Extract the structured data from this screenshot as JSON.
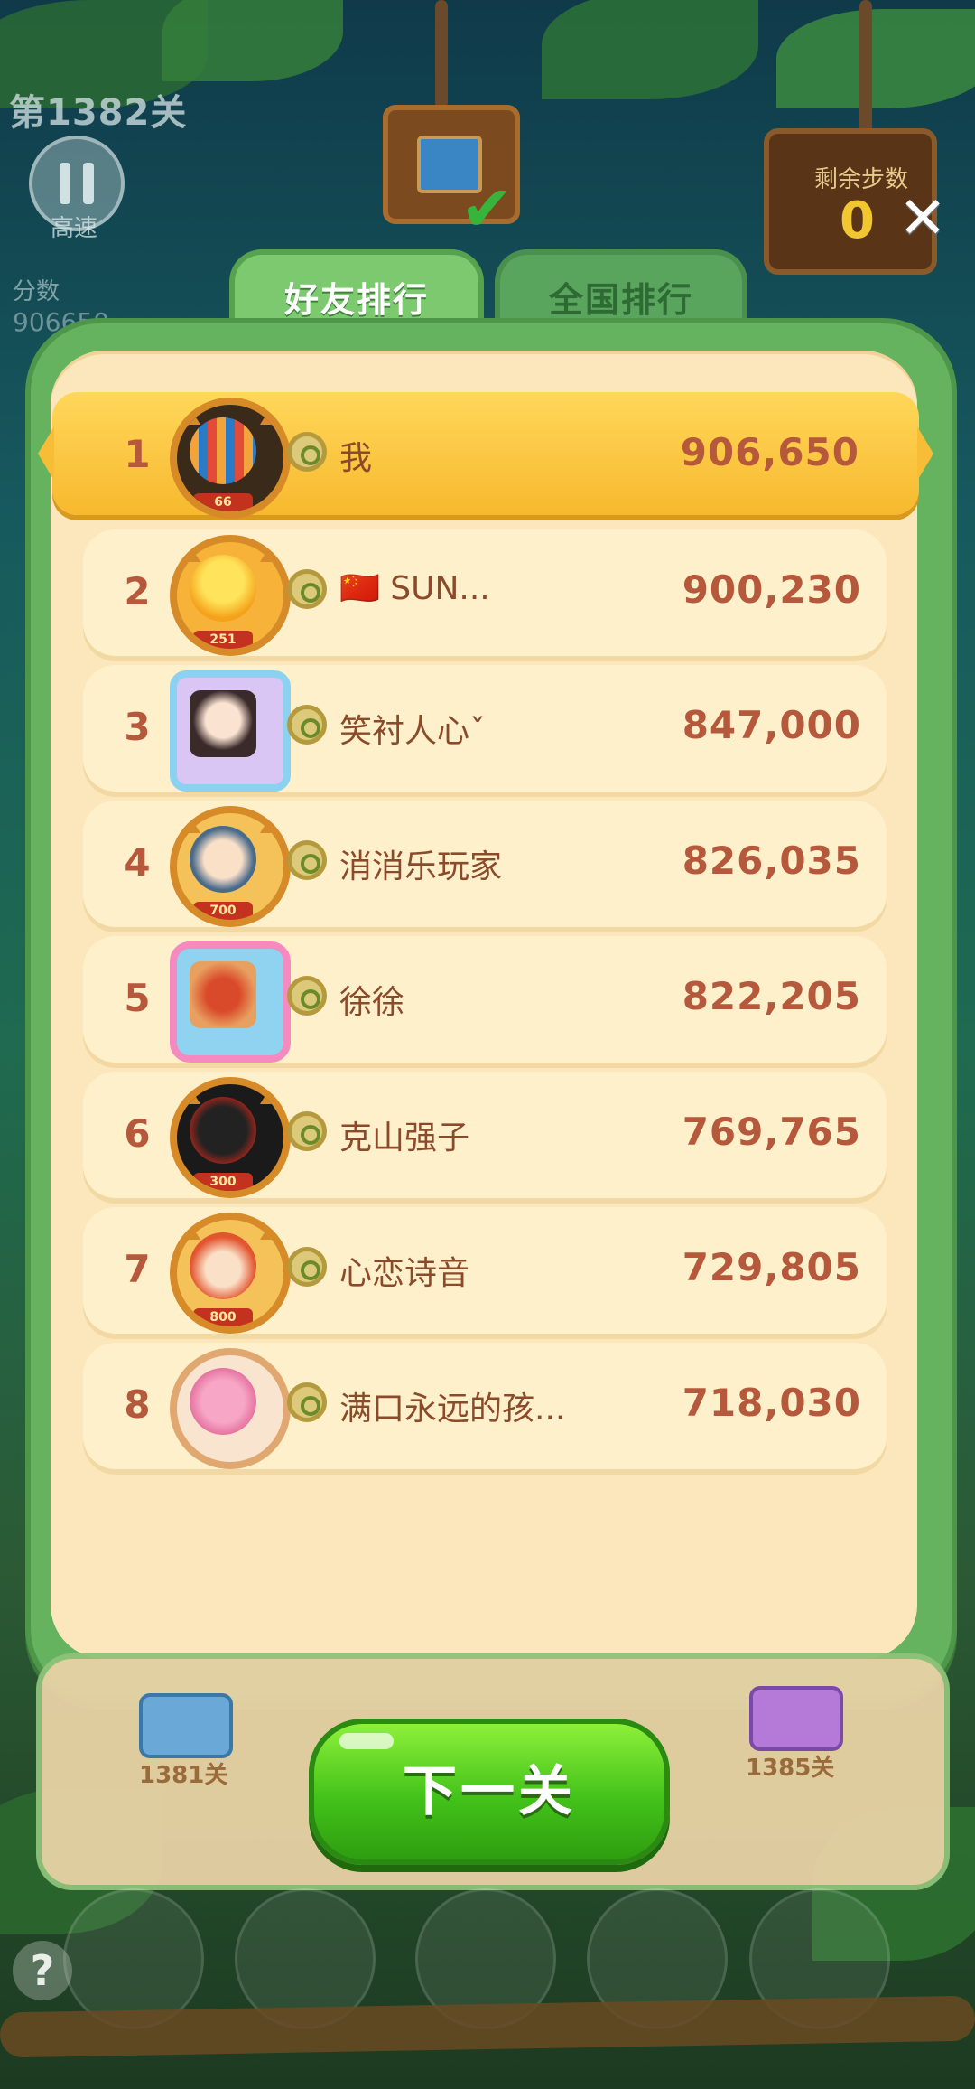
{
  "hud": {
    "level_label": "第1382关",
    "speed_label": "高速",
    "score_label": "分数",
    "score_value": "906650",
    "steps_label": "剩余步数",
    "steps_value": "0"
  },
  "tabs": [
    {
      "label": "好友排行",
      "active": true
    },
    {
      "label": "全国排行",
      "active": false
    }
  ],
  "leaderboard": [
    {
      "rank": "1",
      "name": "我",
      "score": "906,650",
      "level_badge": "66",
      "is_me": true
    },
    {
      "rank": "2",
      "name": "🇨🇳 SUN...",
      "score": "900,230",
      "level_badge": "251"
    },
    {
      "rank": "3",
      "name": "笑衬人心ˇ",
      "score": "847,000",
      "level_badge": ""
    },
    {
      "rank": "4",
      "name": "消消乐玩家",
      "score": "826,035",
      "level_badge": "700"
    },
    {
      "rank": "5",
      "name": "徐徐",
      "score": "822,205",
      "level_badge": ""
    },
    {
      "rank": "6",
      "name": "克山强子",
      "score": "769,765",
      "level_badge": "300"
    },
    {
      "rank": "7",
      "name": "心恋诗音",
      "score": "729,805",
      "level_badge": "800"
    },
    {
      "rank": "8",
      "name": "满口永远的孩...",
      "score": "718,030",
      "level_badge": ""
    }
  ],
  "bottom": {
    "left_level": "1381关",
    "right_level": "1385关",
    "next_button": "下一关",
    "help": "?"
  },
  "colors": {
    "panel_green": "#66b35f",
    "panel_cream": "#fce7bd",
    "my_row_gold": "#f7b92e",
    "rank_text": "#b5583c",
    "next_button_green": "#43c21a"
  },
  "icons": [
    "pause-icon",
    "close-icon",
    "check-icon",
    "badge-icon",
    "help-icon"
  ]
}
